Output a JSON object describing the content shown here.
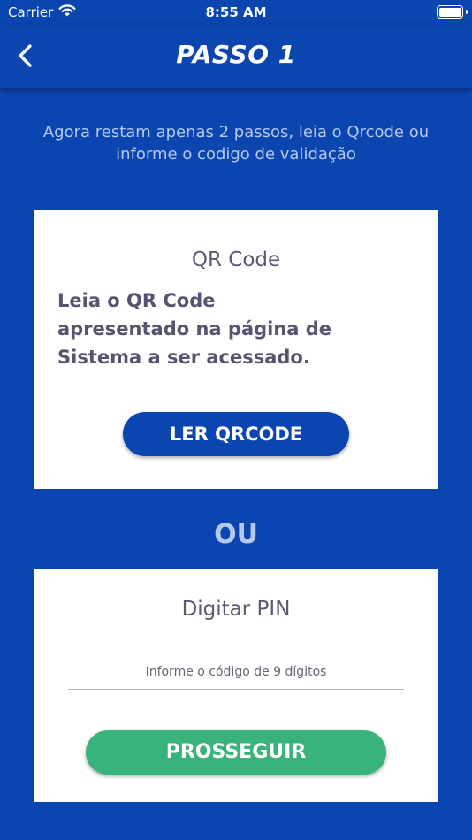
{
  "status_bar": {
    "carrier": "Carrier",
    "time": "8:55 AM",
    "icons": [
      "wifi-icon",
      "battery-icon"
    ]
  },
  "nav": {
    "title": "PASSO 1",
    "back_icon": "chevron-left-icon"
  },
  "intro": {
    "text": "Agora restam apenas 2 passos, leia o Qrcode ou informe o codigo de validação"
  },
  "qr_card": {
    "title": "QR Code",
    "description": "Leia o QR Code apresentado na página de Sistema a ser acessado.",
    "button_label": "LER QRCODE"
  },
  "separator": {
    "label": "OU"
  },
  "pin_card": {
    "title": "Digitar PIN",
    "input_value": "",
    "input_placeholder": "Informe o código de 9 dígitos",
    "button_label": "PROSSEGUIR"
  },
  "colors": {
    "background": "#0b45b0",
    "card": "#ffffff",
    "primary_button": "#0b45b0",
    "proceed_button": "#37b37b",
    "muted_text": "#b6c9ec",
    "card_text": "#555570"
  }
}
